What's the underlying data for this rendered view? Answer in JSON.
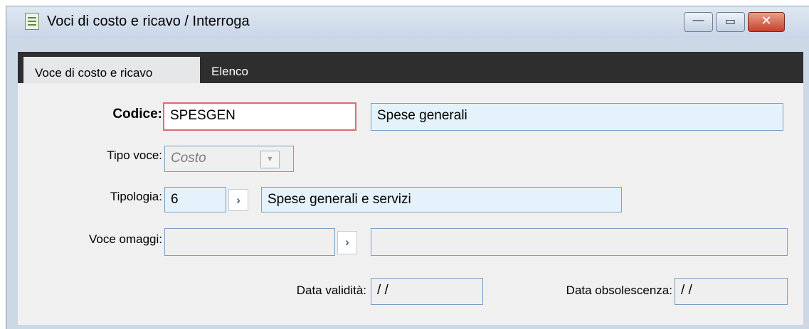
{
  "window": {
    "title": "Voci di costo e ricavo / Interroga",
    "icon": "form-document-icon",
    "buttons": {
      "minimize": "—",
      "maximize": "▭",
      "close": "✕"
    }
  },
  "tabs": [
    {
      "label": "Voce di costo e ricavo",
      "active": true
    },
    {
      "label": "Elenco",
      "active": false
    }
  ],
  "form": {
    "codice": {
      "label": "Codice:",
      "value": "SPESGEN",
      "description": "Spese generali"
    },
    "tipo_voce": {
      "label": "Tipo voce:",
      "value": "Costo",
      "dropdown_icon": "▼"
    },
    "tipologia": {
      "label": "Tipologia:",
      "value": "6",
      "description": "Spese generali e servizi",
      "zoom_icon": "›"
    },
    "voce_omaggi": {
      "label": "Voce omaggi:",
      "value": "",
      "description": "",
      "zoom_icon": "›"
    },
    "data_validita": {
      "label": "Data validità:",
      "value": "/ /"
    },
    "data_obsolescenza": {
      "label": "Data obsolescenza:",
      "value": "/ /"
    }
  },
  "colors": {
    "field_bg": "#e4f3fb",
    "field_border": "#7b9ec2",
    "focus_border": "#e06b6b",
    "tab_strip": "#2e2e2e",
    "panel_bg": "#f0f0f0"
  }
}
